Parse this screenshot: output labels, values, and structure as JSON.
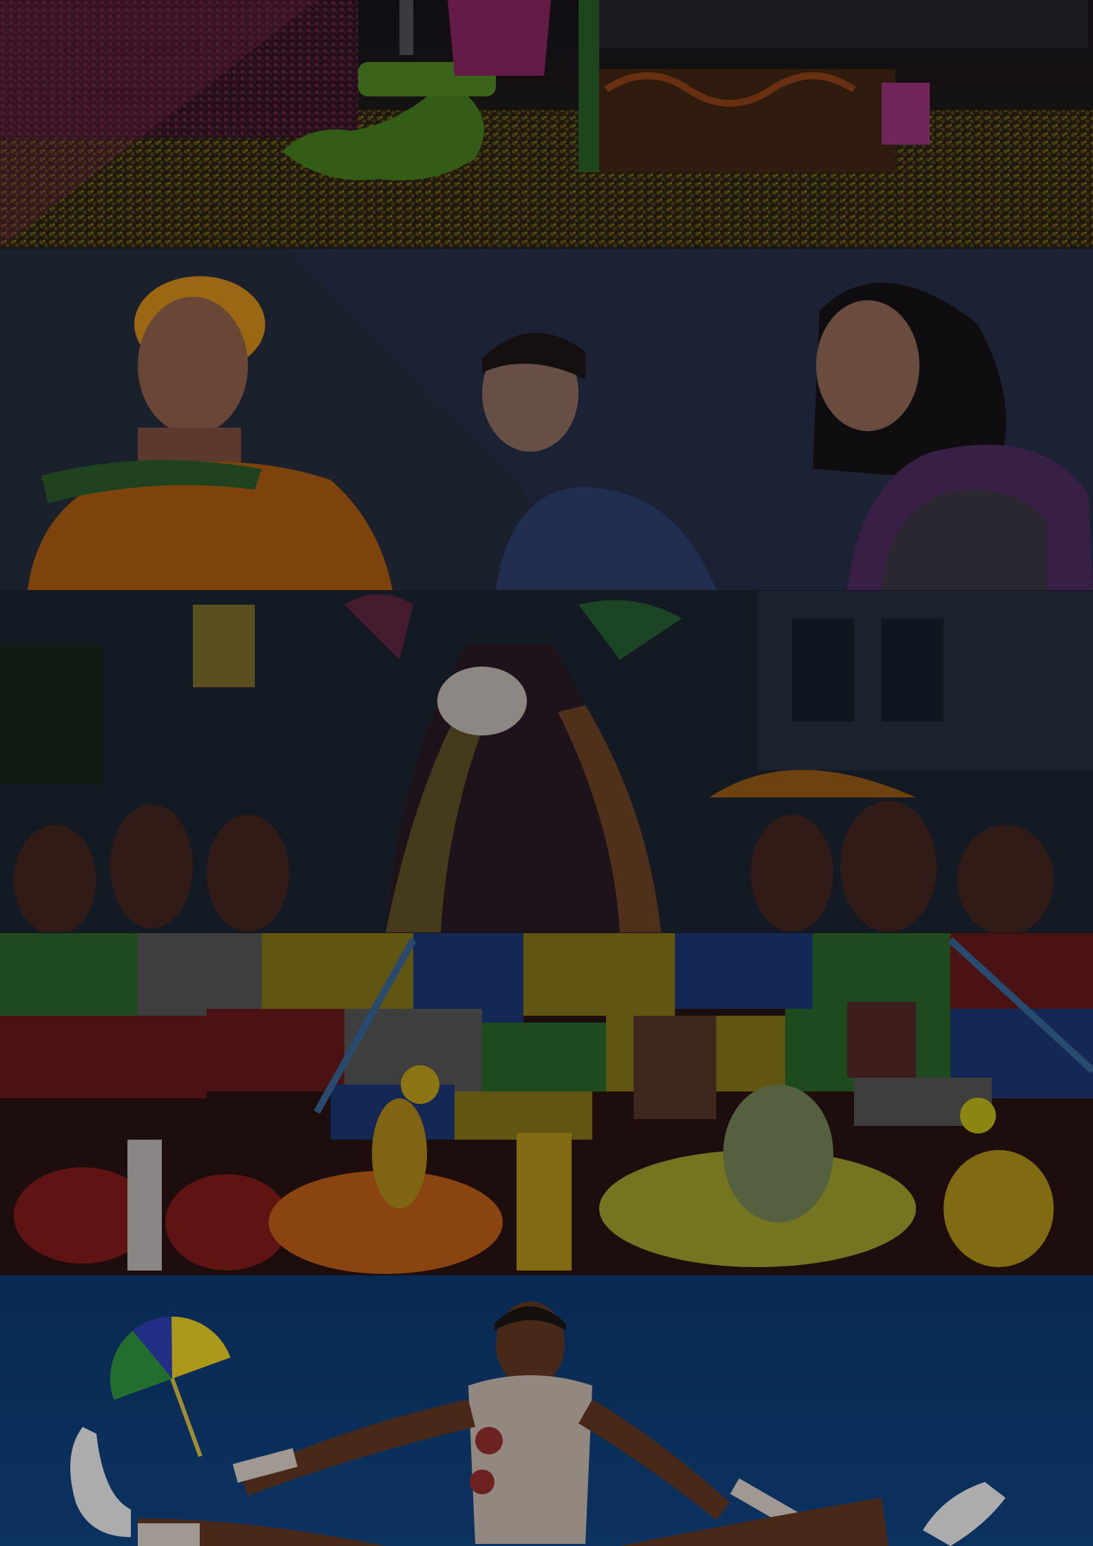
{
  "panels": [
    {
      "name": "carnival-crowd",
      "dim": 0.35,
      "colors": {
        "accent": "#8a2a56",
        "crowd": "#6e5a14",
        "float": "#3e7a1c",
        "sky": "#1c1a22"
      }
    },
    {
      "name": "giant-puppets",
      "dim": 0.25,
      "colors": {
        "sky": "#2a3648",
        "orange": "#c96a14",
        "purple": "#4a2a5e",
        "blue": "#2b3f6a"
      }
    },
    {
      "name": "maracatu-procession",
      "dim": 0.35,
      "colors": {
        "sky": "#26364a",
        "costume": "#3c2a38",
        "beads": "#7a5a2a",
        "umbrella": "#a8641a"
      }
    },
    {
      "name": "quadrilha-dancers",
      "dim": 0.3,
      "colors": {
        "red": "#8a1c1c",
        "yellow": "#b89a1a",
        "blue": "#1e3a7a",
        "green": "#2c6a2a",
        "orange": "#c4621a"
      }
    },
    {
      "name": "frevo-dancer",
      "dim": 0.2,
      "colors": {
        "sky": "#0f3f78",
        "outfit": "#b8aaa0",
        "skin": "#5a3420",
        "umbrella": "#c23030"
      }
    }
  ]
}
